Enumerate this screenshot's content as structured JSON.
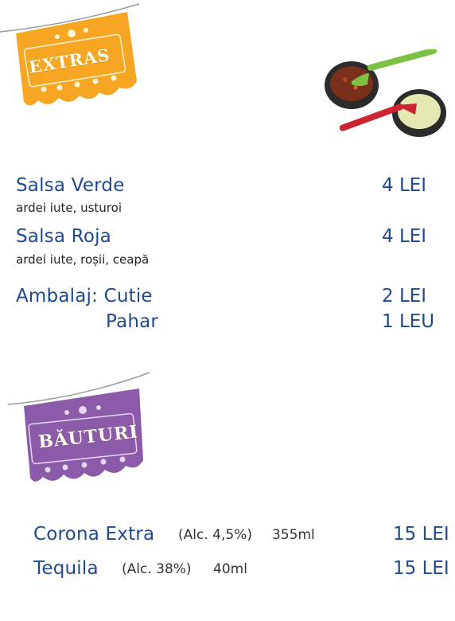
{
  "colors": {
    "text_blue": "#1f4a8f",
    "banner_orange": "#f6a623",
    "banner_purple": "#8b5aa8"
  },
  "extras": {
    "banner_title": "EXTRAS",
    "items": [
      {
        "name": "Salsa Verde",
        "desc": "ardei iute, usturoi",
        "price": "4 LEI"
      },
      {
        "name": "Salsa Roja",
        "desc": "ardei iute, roșii, ceapă",
        "price": "4 LEI"
      }
    ],
    "packaging": {
      "label": "Ambalaj: Cutie",
      "label2": "Pahar",
      "price_box": "2 LEI",
      "price_cup": "1 LEU"
    }
  },
  "drinks": {
    "banner_title": "BĂUTURI",
    "items": [
      {
        "name": "Corona Extra",
        "alc": "(Alc. 4,5%)",
        "volume": "355ml",
        "price": "15 LEI"
      },
      {
        "name": "Tequila",
        "alc": "(Alc. 38%)",
        "volume": "40ml",
        "price": "15 LEI"
      }
    ]
  }
}
